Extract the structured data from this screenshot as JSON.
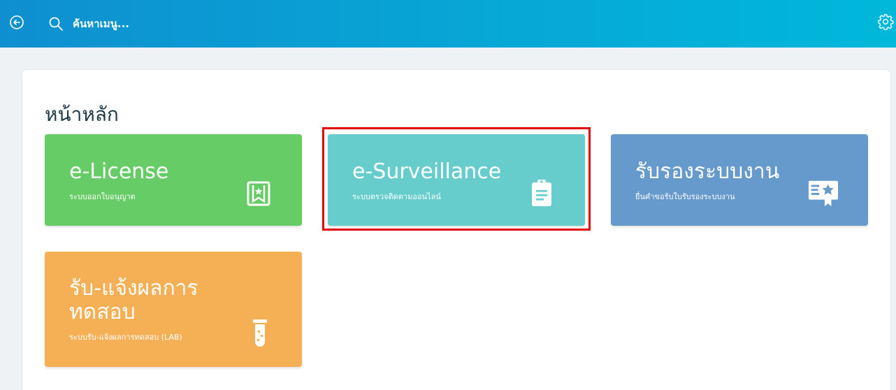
{
  "topbar": {
    "search_placeholder": "ค้นหาเมนู...",
    "gradient_start": "#0f8fd0",
    "gradient_end": "#00b8da",
    "back_icon": "circle-arrow-left-icon",
    "search_icon": "search-icon",
    "settings_icon": "gear-icon"
  },
  "main": {
    "title": "หน้าหลัก",
    "tiles": [
      {
        "title": "e-License",
        "subtitle": "ระบบออกใบอนุญาต",
        "color": "#66cc66",
        "icon": "bookmark-star-icon"
      },
      {
        "title": "e-Surveillance",
        "subtitle": "ระบบตรวจติดตามออนไลน์",
        "color": "#66cccc",
        "icon": "clipboard-list-icon"
      },
      {
        "title": "รับรองระบบงาน",
        "subtitle": "ยื่นคำขอรับใบรับรองระบบงาน",
        "color": "#6699cc",
        "icon": "certificate-star-icon"
      },
      {
        "title_line1": "รับ-แจ้งผลการ",
        "title_line2": "ทดสอบ",
        "subtitle": "ระบบรับ-แจ้งผลการทดสอบ (LAB)",
        "color": "#f5b055",
        "icon": "test-tube-icon"
      }
    ]
  },
  "highlight_color": "#e00000"
}
